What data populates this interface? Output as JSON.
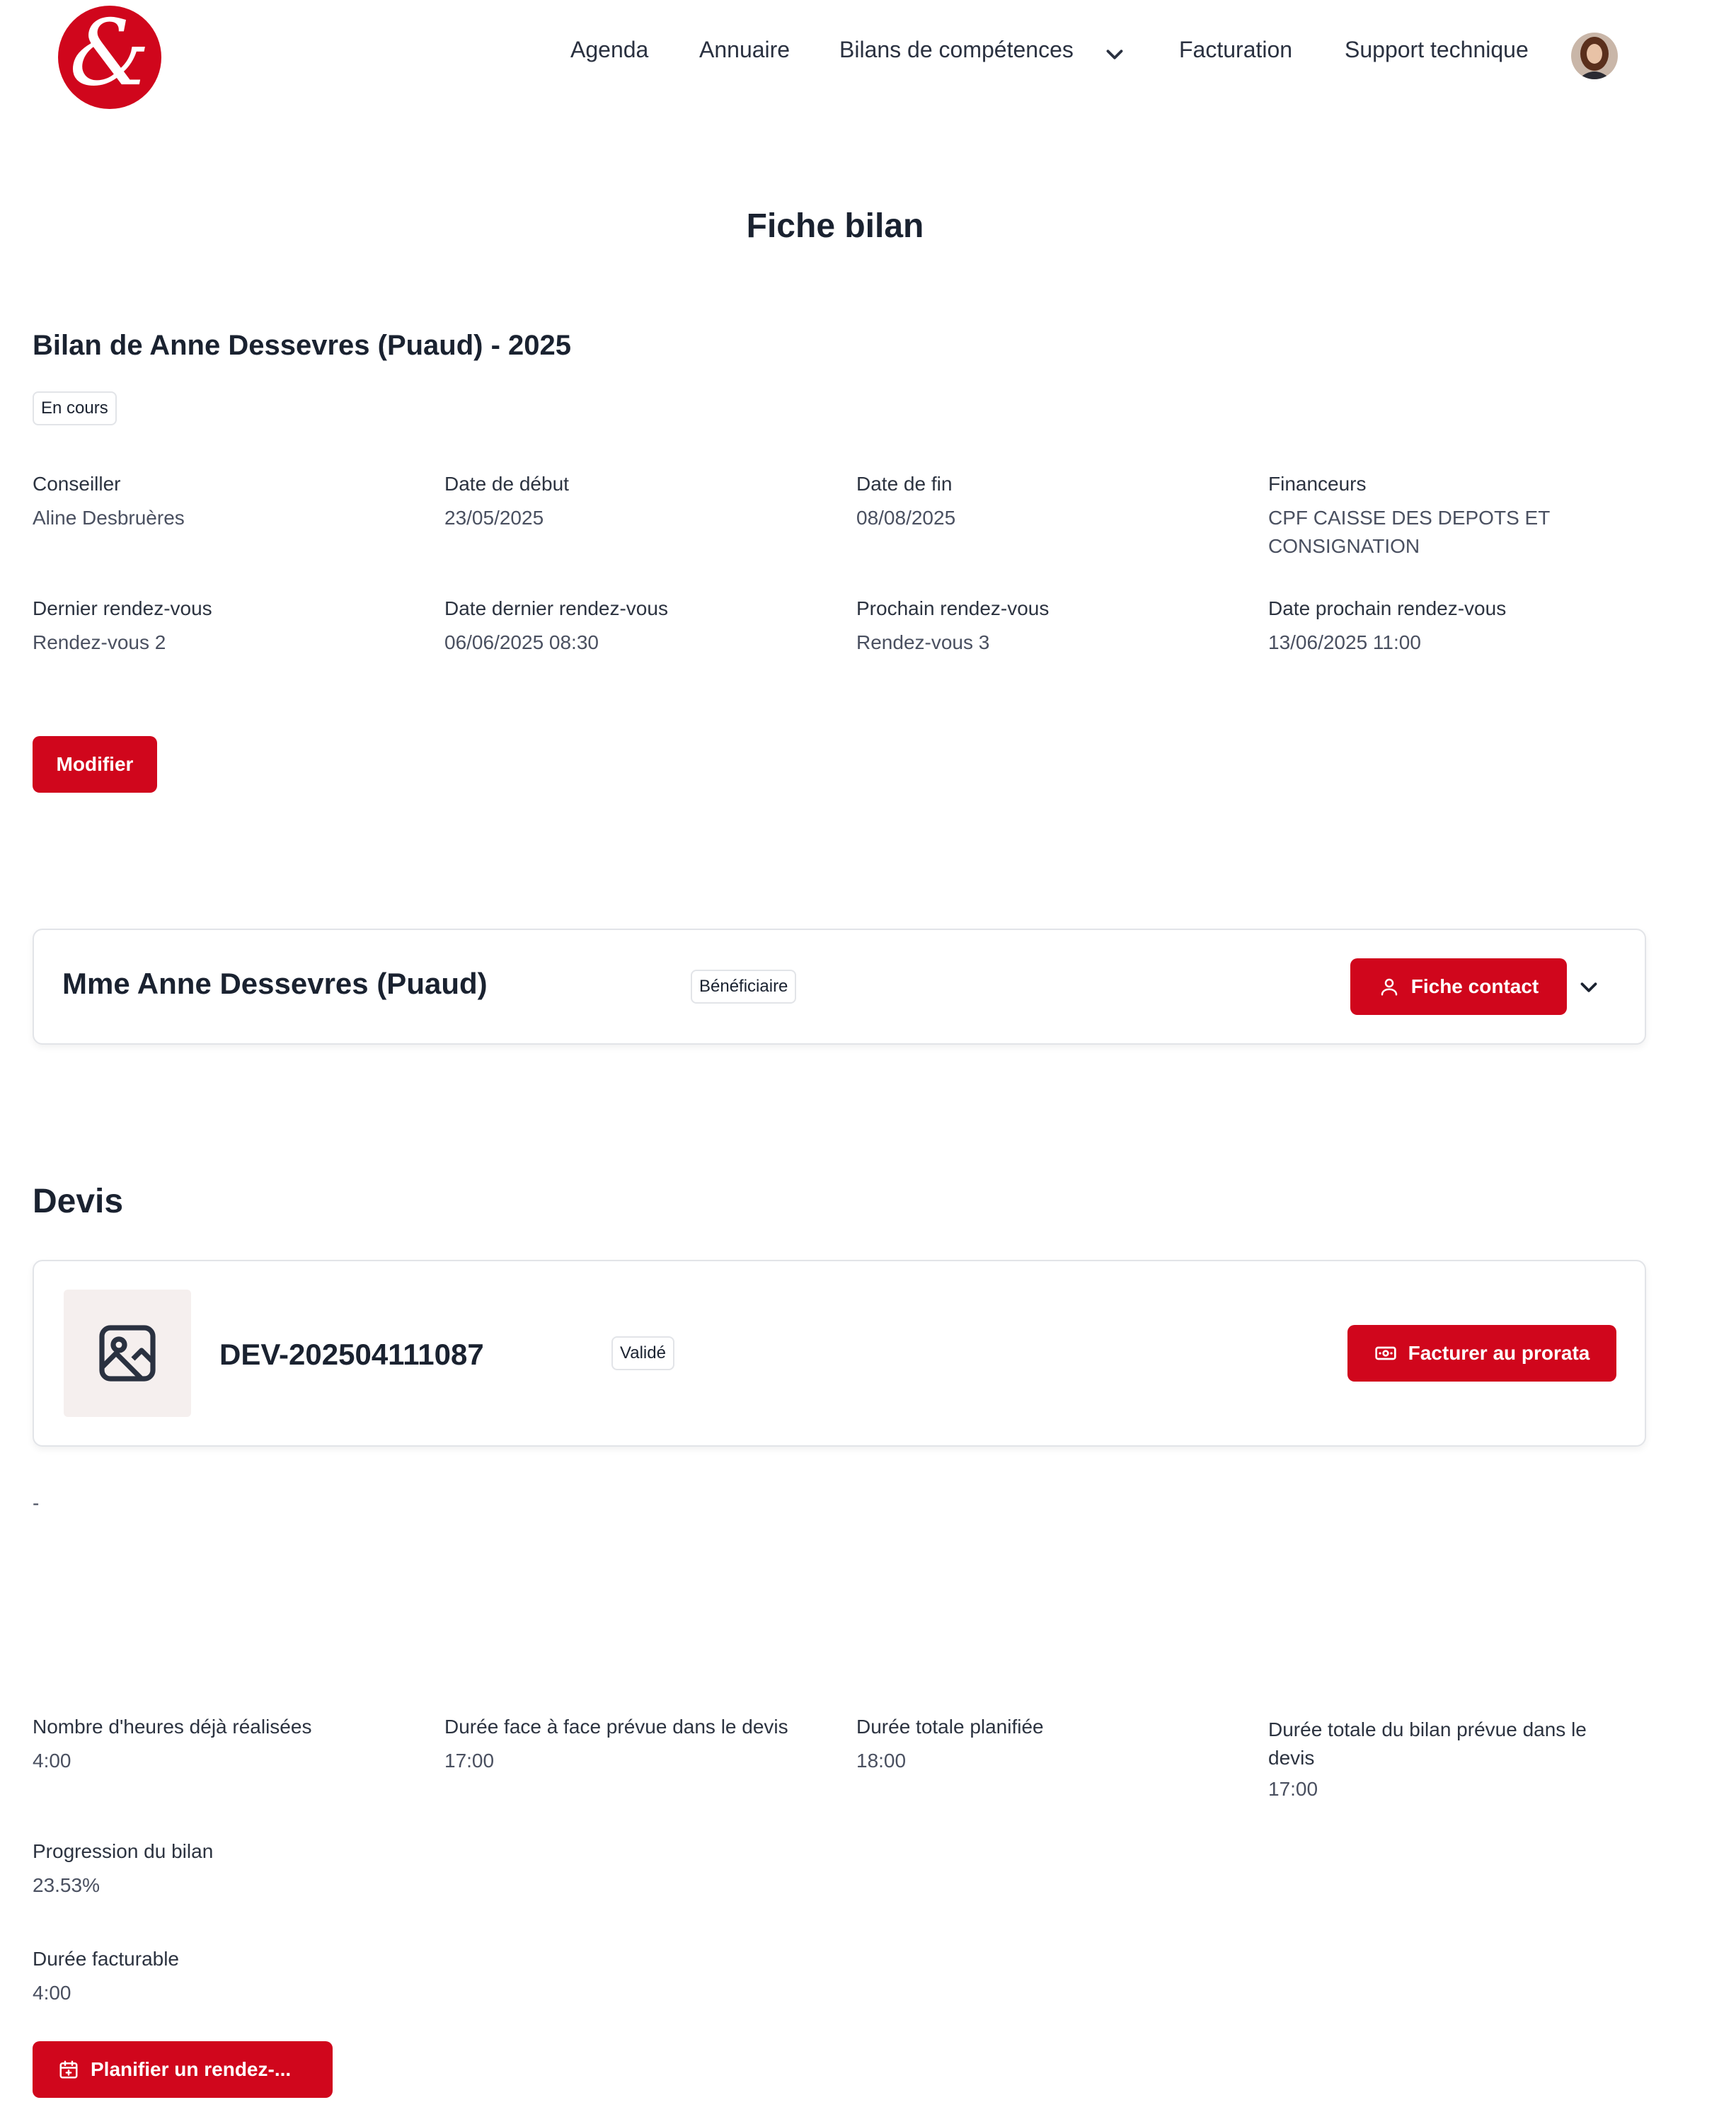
{
  "header": {
    "logo_symbol": "&",
    "nav": {
      "agenda": "Agenda",
      "annuaire": "Annuaire",
      "bilans": "Bilans de compétences",
      "facturation": "Facturation",
      "support": "Support technique"
    }
  },
  "page_title": "Fiche bilan",
  "bilan": {
    "title": "Bilan de Anne Dessevres (Puaud) - 2025",
    "status": "En cours",
    "fields": {
      "conseiller_label": "Conseiller",
      "conseiller_value": "Aline Desbruères",
      "date_debut_label": "Date de début",
      "date_debut_value": "23/05/2025",
      "date_fin_label": "Date de fin",
      "date_fin_value": "08/08/2025",
      "financeurs_label": "Financeurs",
      "financeurs_value": "CPF CAISSE DES DEPOTS ET CONSIGNATION",
      "dernier_rdv_label": "Dernier rendez-vous",
      "dernier_rdv_value": "Rendez-vous 2",
      "date_dernier_rdv_label": "Date dernier rendez-vous",
      "date_dernier_rdv_value": "06/06/2025 08:30",
      "prochain_rdv_label": "Prochain rendez-vous",
      "prochain_rdv_value": "Rendez-vous 3",
      "date_prochain_rdv_label": "Date prochain rendez-vous",
      "date_prochain_rdv_value": "13/06/2025 11:00"
    },
    "modifier_label": "Modifier"
  },
  "beneficiaire": {
    "name": "Mme Anne Dessevres (Puaud)",
    "role": "Bénéficiaire",
    "fiche_contact_label": "Fiche contact"
  },
  "devis": {
    "heading": "Devis",
    "reference": "DEV-202504111087",
    "status": "Validé",
    "facturer_label": "Facturer au prorata",
    "dash": "-"
  },
  "stats": {
    "heures_realisees_label": "Nombre d'heures déjà réalisées",
    "heures_realisees_value": "4:00",
    "duree_face_label": "Durée face à face prévue dans le devis",
    "duree_face_value": "17:00",
    "duree_planifiee_label": "Durée totale planifiée",
    "duree_planifiee_value": "18:00",
    "duree_bilan_label": "Durée totale du bilan prévue dans le devis",
    "duree_bilan_value": "17:00",
    "progression_label": "Progression du bilan",
    "progression_value": "23.53%",
    "duree_facturable_label": "Durée facturable",
    "duree_facturable_value": "4:00"
  },
  "planifier_label": "Planifier un rendez-...",
  "colors": {
    "accent": "#d0061c",
    "text": "#1a2230",
    "muted": "#4a5060",
    "border": "#e2e4e8"
  },
  "icons": [
    "chevron-down-icon",
    "user-icon",
    "image-icon",
    "banknote-icon",
    "calendar-plus-icon"
  ]
}
